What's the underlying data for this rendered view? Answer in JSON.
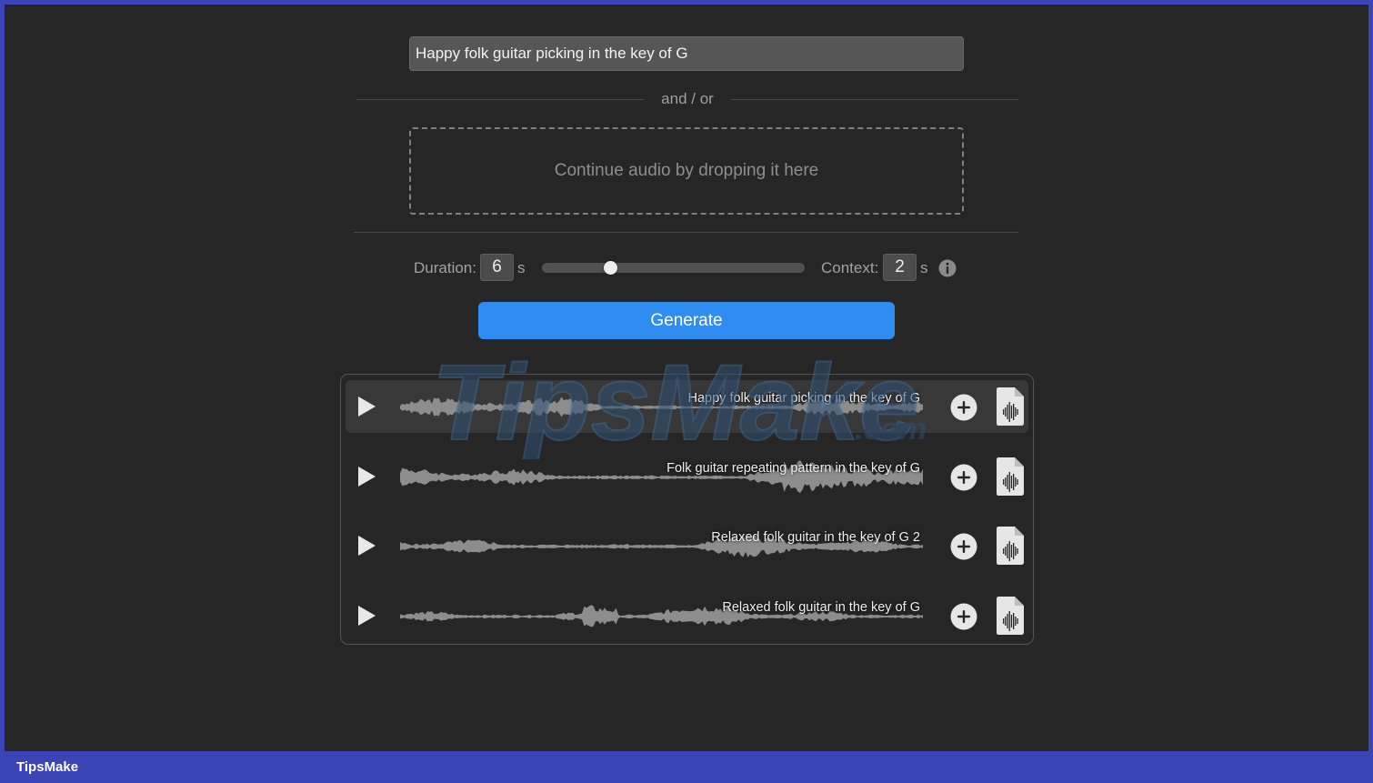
{
  "prompt": {
    "value": "Happy folk guitar picking in the key of G"
  },
  "separator": {
    "label": "and / or"
  },
  "dropzone": {
    "label": "Continue audio by dropping it here"
  },
  "controls": {
    "duration_label": "Duration:",
    "duration_value": "6",
    "duration_unit": "s",
    "slider_fraction": 0.26,
    "context_label": "Context:",
    "context_value": "2",
    "context_unit": "s"
  },
  "generate": {
    "label": "Generate"
  },
  "results": [
    {
      "title": "Happy folk guitar picking in the key of G",
      "selected": true
    },
    {
      "title": "Folk guitar repeating pattern in the key of G",
      "selected": false
    },
    {
      "title": "Relaxed folk guitar in the key of G 2",
      "selected": false
    },
    {
      "title": "Relaxed folk guitar in the key of G",
      "selected": false
    }
  ],
  "watermark": {
    "text": "TipsMake",
    "suffix": ".com"
  },
  "footer": {
    "brand": "TipsMake"
  },
  "colors": {
    "accent": "#2f8cf0",
    "frame": "#3b44b4",
    "background": "#262626"
  },
  "icons": {
    "play": "play-icon",
    "add": "plus-circle-icon",
    "file": "audio-file-icon",
    "info": "info-icon"
  }
}
